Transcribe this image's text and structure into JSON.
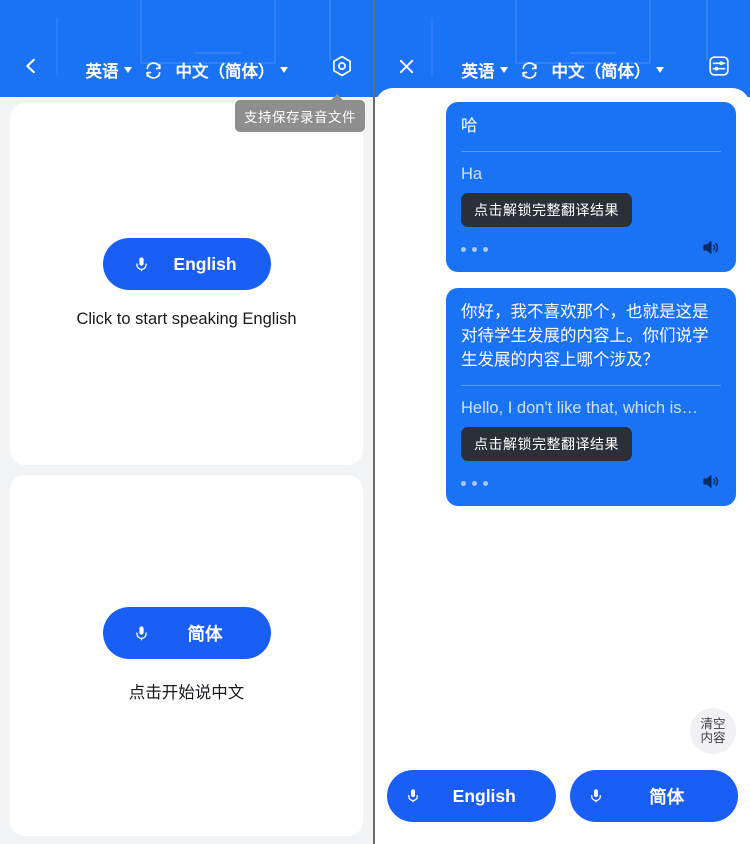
{
  "colors": {
    "brand_blue": "#1a72f5",
    "button_blue": "#1a5ff5",
    "panel_bg": "#f2f3f5",
    "card_white": "#ffffff",
    "chip_dark": "#2b2f38",
    "tooltip_gray": "#8e8e8e",
    "translation_text": "#cfe0fb"
  },
  "left_panel": {
    "header": {
      "back_icon": "chevron-left-icon",
      "source_language": "英语",
      "swap_icon": "swap-arrows-icon",
      "target_language": "中文（简体）",
      "settings_icon": "hexagon-gear-icon"
    },
    "tooltip": "支持保存录音文件",
    "cards": [
      {
        "mic_icon": "microphone-icon",
        "button_label": "English",
        "hint": "Click to start speaking English"
      },
      {
        "mic_icon": "microphone-icon",
        "button_label": "简体",
        "hint": "点击开始说中文"
      }
    ]
  },
  "right_panel": {
    "header": {
      "close_icon": "close-x-icon",
      "source_language": "英语",
      "swap_icon": "swap-arrows-icon",
      "target_language": "中文（简体）",
      "settings_icon": "sliders-icon"
    },
    "messages": [
      {
        "source_text": "哈",
        "translated_text": "Ha",
        "unlock_label": "点击解锁完整翻译结果",
        "speaker_icon": "speaker-icon",
        "loading_dots": 3
      },
      {
        "source_text": "你好，我不喜欢那个，也就是这是对待学生发展的内容上。你们说学生发展的内容上哪个涉及？",
        "translated_text": "Hello, I don't like that, which is…",
        "unlock_label": "点击解锁完整翻译结果",
        "speaker_icon": "speaker-icon",
        "loading_dots": 3
      }
    ],
    "clear_button": {
      "line1": "清空",
      "line2": "内容"
    },
    "footer_buttons": [
      {
        "mic_icon": "microphone-icon",
        "label": "English"
      },
      {
        "mic_icon": "microphone-icon",
        "label": "简体"
      }
    ]
  }
}
